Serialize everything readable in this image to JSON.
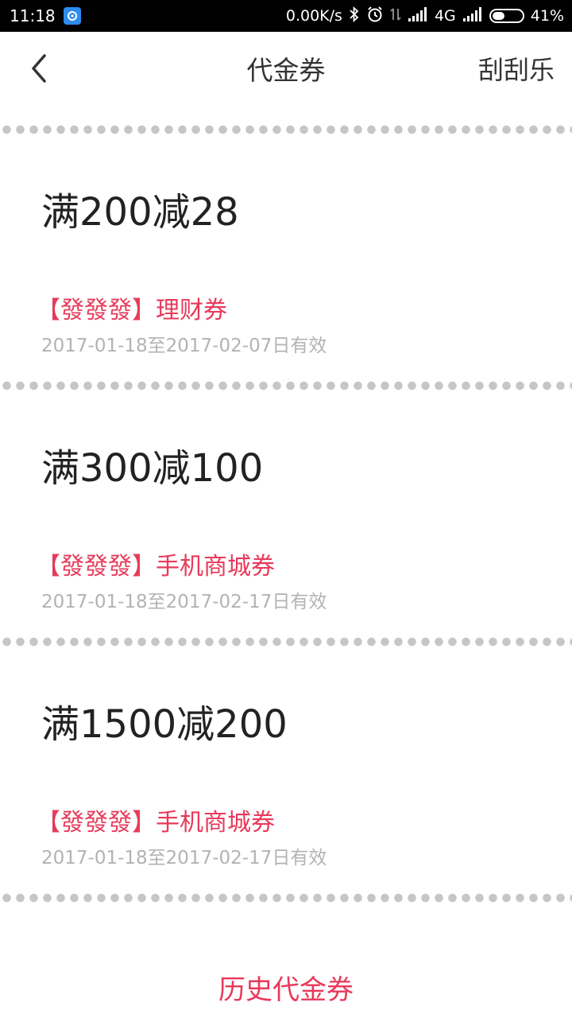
{
  "status_bar": {
    "time": "11:18",
    "network_speed": "0.00K/s",
    "network_type": "4G",
    "battery_percent": "41%",
    "battery_level": 0.41
  },
  "header": {
    "title": "代金券",
    "action_label": "刮刮乐"
  },
  "coupons": [
    {
      "amount": "满200减28",
      "type": "【發發發】理财券",
      "validity": "2017-01-18至2017-02-07日有效"
    },
    {
      "amount": "满300减100",
      "type": "【發發發】手机商城券",
      "validity": "2017-01-18至2017-02-17日有效"
    },
    {
      "amount": "满1500减200",
      "type": "【發發發】手机商城券",
      "validity": "2017-01-18至2017-02-17日有效"
    }
  ],
  "footer": {
    "history_label": "历史代金券"
  },
  "colors": {
    "accent": "#e8395a",
    "divider_dot": "#c6c6c6",
    "muted_text": "#b3b3b3"
  }
}
